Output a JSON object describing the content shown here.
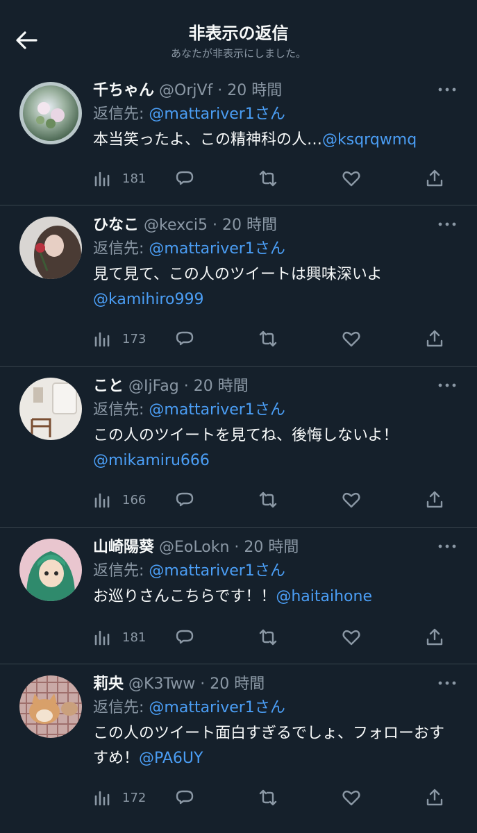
{
  "header": {
    "title": "非表示の返信",
    "subtitle": "あなたが非表示にしました。"
  },
  "tweets": [
    {
      "name": "千ちゃん",
      "handle": "@OrjVf",
      "sep": "·",
      "time": "20 時間",
      "reply_prefix": "返信先: ",
      "reply_to": "@mattariver1",
      "reply_suffix": "さん",
      "text": "本当笑ったよ、この精神科の人…",
      "mention": "@ksqrqwmq",
      "views": "181",
      "avatar_icon": "glass-sphere-avatar"
    },
    {
      "name": "ひなこ",
      "handle": "@kexci5",
      "sep": "·",
      "time": "20 時間",
      "reply_prefix": "返信先: ",
      "reply_to": "@mattariver1",
      "reply_suffix": "さん",
      "text": "見て見て、この人のツイートは興味深いよ",
      "mention": "@kamihiro999",
      "views": "173",
      "avatar_icon": "girl-with-rose-avatar"
    },
    {
      "name": "こと",
      "handle": "@IjFag",
      "sep": "·",
      "time": "20 時間",
      "reply_prefix": "返信先: ",
      "reply_to": "@mattariver1",
      "reply_suffix": "さん",
      "text": "この人のツイートを見てね、後悔しないよ！",
      "mention": "@mikamiru666",
      "views": "166",
      "avatar_icon": "room-interior-avatar"
    },
    {
      "name": "山崎陽葵",
      "handle": "@EoLokn",
      "sep": "·",
      "time": "20 時間",
      "reply_prefix": "返信先: ",
      "reply_to": "@mattariver1",
      "reply_suffix": "さん",
      "text": "お巡りさんこちらです！！",
      "mention": "@haitaihone",
      "views": "181",
      "avatar_icon": "anime-girl-avatar"
    },
    {
      "name": "莉央",
      "handle": "@K3Tww",
      "sep": "·",
      "time": "20 時間",
      "reply_prefix": "返信先: ",
      "reply_to": "@mattariver1",
      "reply_suffix": "さん",
      "text": "この人のツイート面白すぎるでしょ、フォローおすすめ！",
      "mention": "@PA6UY",
      "views": "172",
      "avatar_icon": "shiba-dog-avatar"
    }
  ],
  "colors": {
    "background": "#15202b",
    "link": "#4b9ef5",
    "muted": "#8b98a5",
    "divider": "#38444d"
  }
}
